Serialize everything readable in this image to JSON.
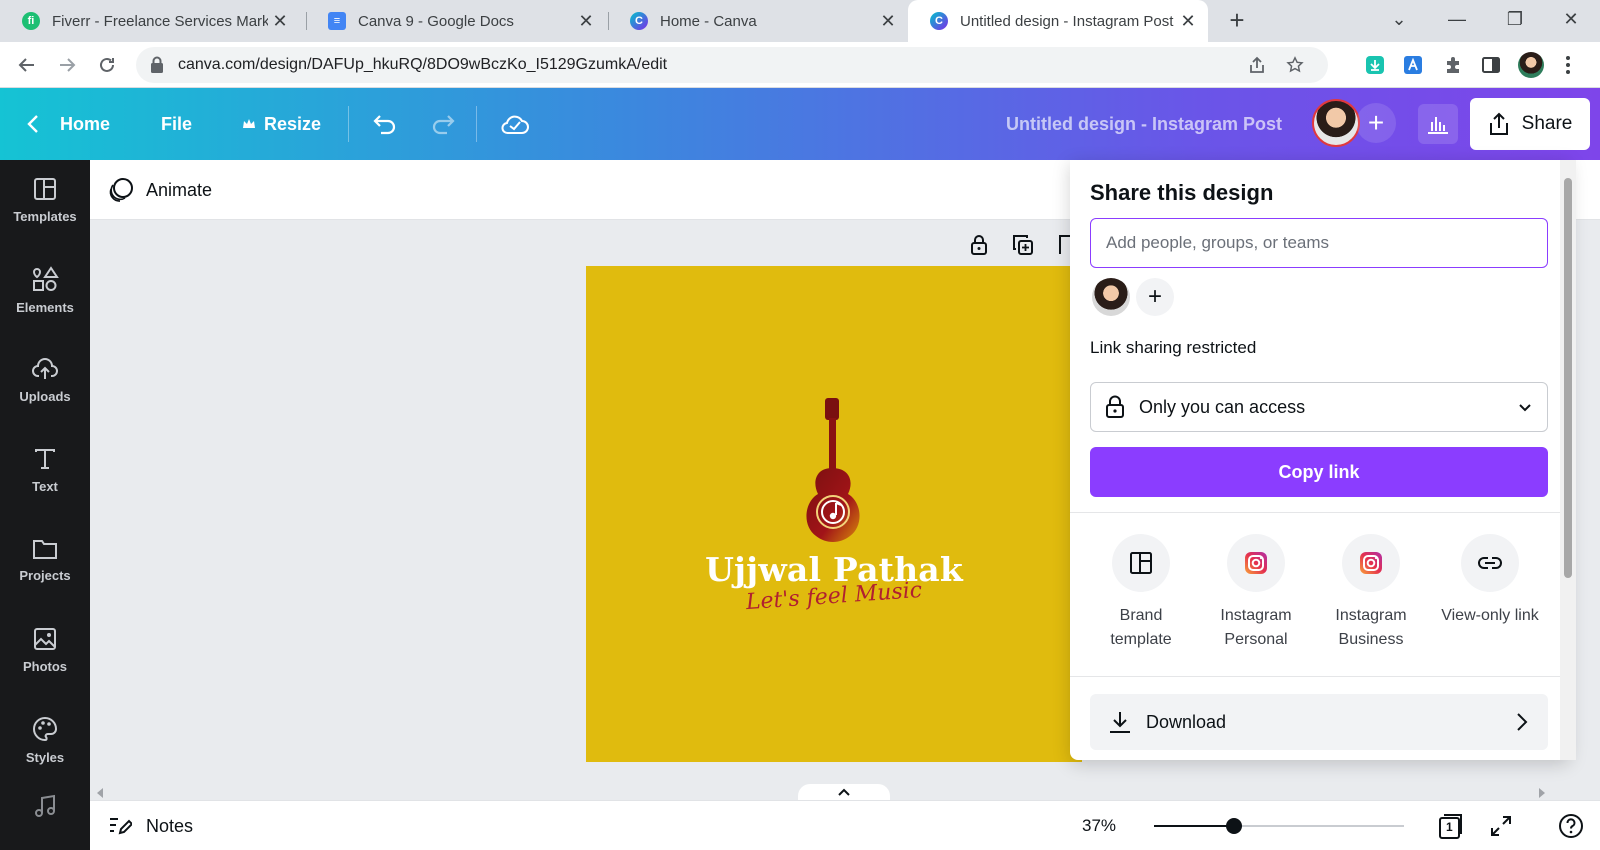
{
  "browser": {
    "tabs": [
      {
        "title": "Fiverr - Freelance Services Marketplace",
        "favicon_letter": "fi",
        "favicon_color": "#1dbf73"
      },
      {
        "title": "Canva 9 - Google Docs",
        "favicon_letter": "≡",
        "favicon_color": "#4285f4"
      },
      {
        "title": "Home - Canva",
        "favicon_letter": "C",
        "favicon_color": "#00c4cc"
      },
      {
        "title": "Untitled design - Instagram Post",
        "favicon_letter": "C",
        "favicon_color": "#00c4cc"
      }
    ],
    "close_glyph": "✕",
    "new_tab_glyph": "+",
    "window_controls": [
      "⌄",
      "—",
      "❐",
      "✕"
    ],
    "url": "canva.com/design/DAFUp_hkuRQ/8DO9wBczKo_I5129GzumkA/edit"
  },
  "topbar": {
    "home_label": "Home",
    "file_label": "File",
    "resize_label": "Resize",
    "design_title": "Untitled design - Instagram Post",
    "add_glyph": "+",
    "share_label": "Share"
  },
  "sidebar": {
    "items": [
      {
        "label": "Templates",
        "icon": "templates-icon"
      },
      {
        "label": "Elements",
        "icon": "elements-icon"
      },
      {
        "label": "Uploads",
        "icon": "uploads-icon"
      },
      {
        "label": "Text",
        "icon": "text-icon"
      },
      {
        "label": "Projects",
        "icon": "projects-icon"
      },
      {
        "label": "Photos",
        "icon": "photos-icon"
      },
      {
        "label": "Styles",
        "icon": "styles-icon"
      }
    ]
  },
  "toolbar": {
    "animate_label": "Animate"
  },
  "design": {
    "background_color": "#e0bb0e",
    "brand_name": "Ujjwal Pathak",
    "tagline": "Let's feel Music"
  },
  "share_panel": {
    "title": "Share this design",
    "people_placeholder": "Add people, groups, or teams",
    "add_glyph": "+",
    "link_label": "Link sharing restricted",
    "access_value": "Only you can access",
    "copy_link_label": "Copy link",
    "options": [
      {
        "label_1": "Brand",
        "label_2": "template",
        "icon": "brand-template-icon"
      },
      {
        "label_1": "Instagram",
        "label_2": "Personal",
        "icon": "instagram-icon"
      },
      {
        "label_1": "Instagram",
        "label_2": "Business",
        "icon": "instagram-icon"
      },
      {
        "label_1": "View-only link",
        "label_2": "",
        "icon": "link-icon"
      }
    ],
    "download_label": "Download",
    "accent_color": "#8b3dff"
  },
  "bottombar": {
    "notes_label": "Notes",
    "zoom_value": "37%",
    "zoom_fraction": 0.32,
    "page_count": "1"
  }
}
